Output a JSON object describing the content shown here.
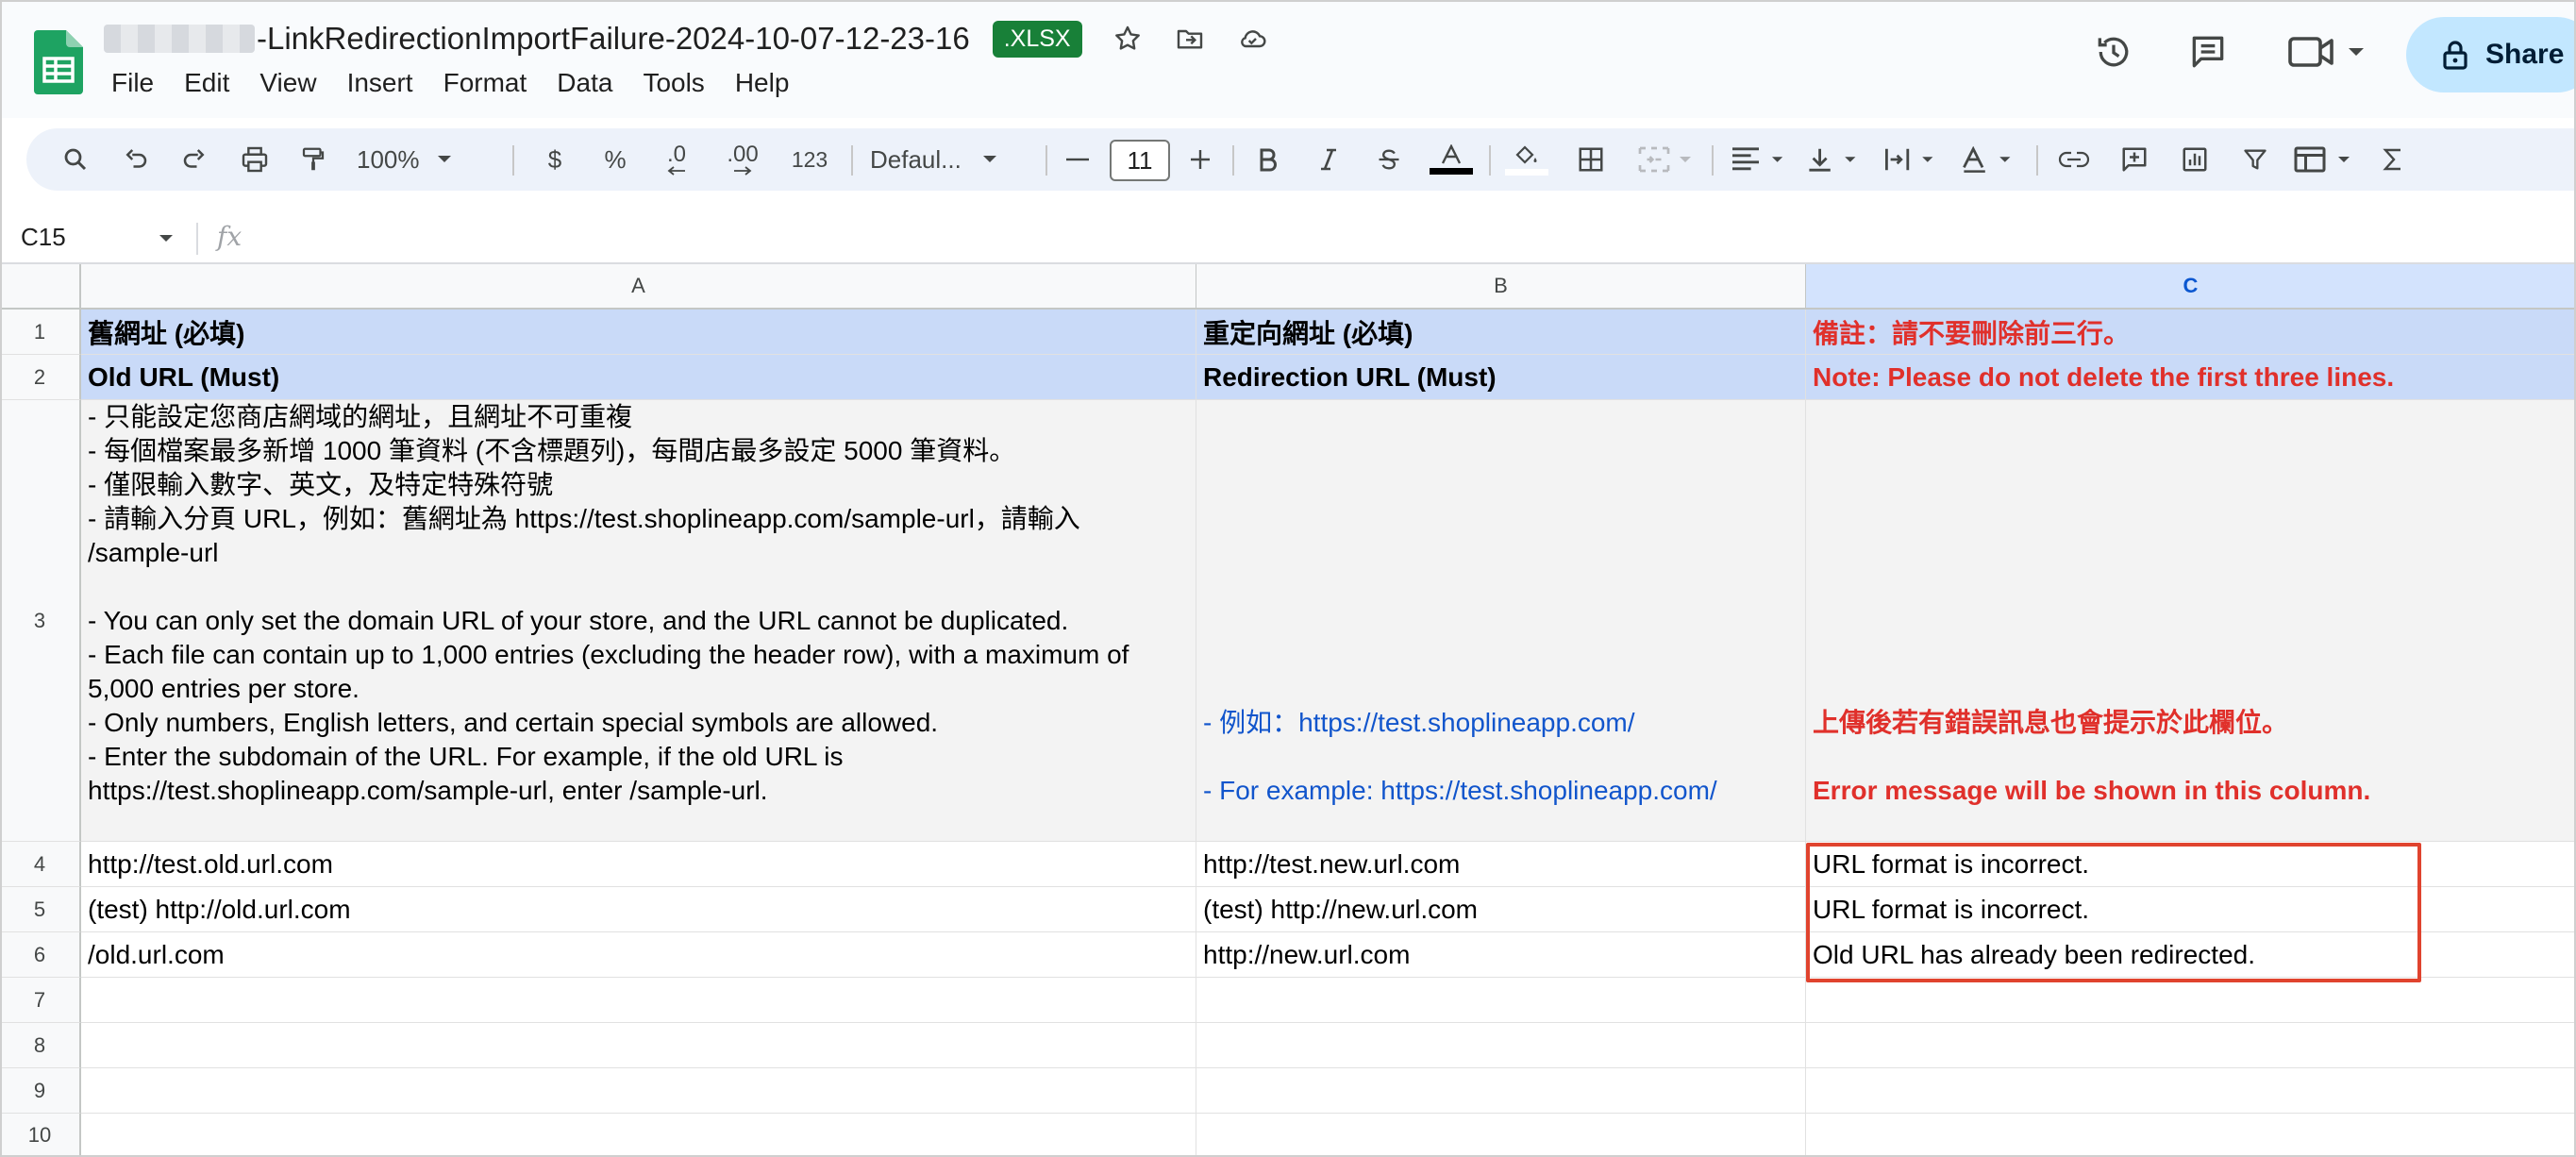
{
  "document": {
    "title": "-LinkRedirectionImportFailure-2024-10-07-12-23-16",
    "badge": ".XLSX"
  },
  "menu": [
    "File",
    "Edit",
    "View",
    "Insert",
    "Format",
    "Data",
    "Tools",
    "Help"
  ],
  "actions": {
    "share_label": "Share"
  },
  "toolbar": {
    "zoom": "100%",
    "currency": "$",
    "percent": "%",
    "decrease_decimal": ".0",
    "increase_decimal": ".00",
    "number_format": "123",
    "font": "Defaul...",
    "font_size": "11"
  },
  "formula_bar": {
    "cell_ref": "C15",
    "fx": "fx"
  },
  "sheet": {
    "columns": [
      "A",
      "B",
      "C"
    ],
    "row_numbers": [
      "1",
      "2",
      "3",
      "4",
      "5",
      "6",
      "7",
      "8",
      "9",
      "10"
    ],
    "row1": {
      "a": "舊網址 (必填)",
      "b": "重定向網址 (必填)",
      "c": "備註：請不要刪除前三行。"
    },
    "row2": {
      "a": "Old URL (Must)",
      "b": "Redirection URL (Must)",
      "c": "Note: Please do not delete the first three lines."
    },
    "row3": {
      "a_lines": [
        "- 只能設定您商店網域的網址，且網址不可重複",
        "- 每個檔案最多新增 1000 筆資料 (不含標題列)，每間店最多設定 5000 筆資料。",
        "- 僅限輸入數字、英文，及特定特殊符號",
        "- 請輸入分頁 URL，例如：舊網址為 https://test.shoplineapp.com/sample-url，請輸入",
        "/sample-url",
        "",
        "- You can only set the domain URL of your store, and the URL cannot be duplicated.",
        "- Each file can contain up to 1,000 entries (excluding the header row), with a maximum of",
        "5,000 entries per store.",
        "- Only numbers, English letters, and certain special symbols are allowed.",
        "- Enter the subdomain of the URL. For example, if the old URL is",
        "https://test.shoplineapp.com/sample-url, enter /sample-url."
      ],
      "b_lines": [
        "- 例如：https://test.shoplineapp.com/",
        "",
        "- For example: https://test.shoplineapp.com/"
      ],
      "c_lines": [
        "上傳後若有錯誤訊息也會提示於此欄位。",
        "",
        "Error message will be shown in this column."
      ]
    },
    "data_rows": [
      {
        "a": "http://test.old.url.com",
        "b": "http://test.new.url.com",
        "c": "URL format is incorrect."
      },
      {
        "a": "(test) http://old.url.com",
        "b": "(test) http://new.url.com",
        "c": "URL format is incorrect."
      },
      {
        "a": "/old.url.com",
        "b": "http://new.url.com",
        "c": "Old URL has already been redirected."
      }
    ]
  },
  "colors": {
    "header_fill": "#c9daf8",
    "note_fill": "#f3f3f3",
    "red_text": "#e0302b",
    "blue_text": "#1155cc",
    "highlight_border": "#e0432e",
    "badge_green": "#188038"
  }
}
